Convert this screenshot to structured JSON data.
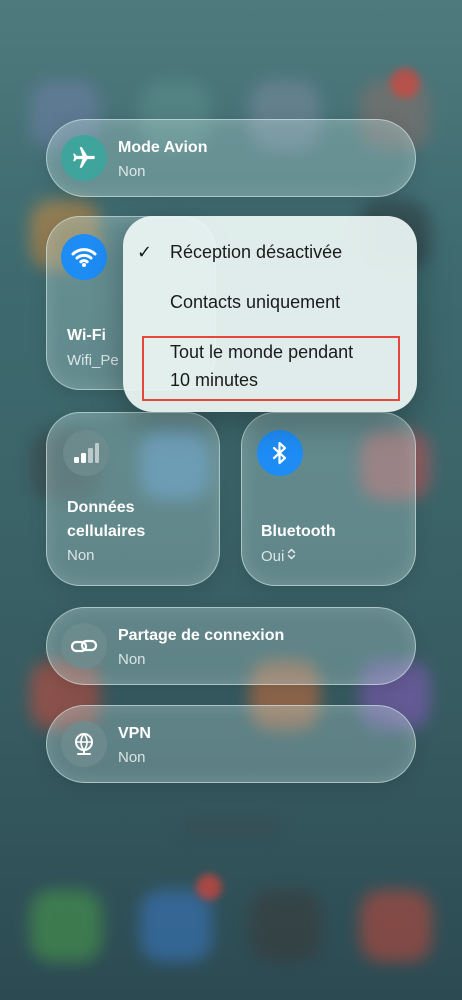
{
  "airplane": {
    "title": "Mode Avion",
    "status": "Non"
  },
  "wifi": {
    "title": "Wi-Fi",
    "network": "Wifi_Pe"
  },
  "cellular": {
    "title_line1": "Données",
    "title_line2": "cellulaires",
    "status": "Non"
  },
  "bluetooth": {
    "title": "Bluetooth",
    "status": "Oui",
    "chevron": "⌃⌄"
  },
  "hotspot": {
    "title": "Partage de connexion",
    "status": "Non"
  },
  "vpn": {
    "title": "VPN",
    "status": "Non"
  },
  "airdrop_menu": {
    "check": "✓",
    "items": [
      {
        "label": "Réception désactivée"
      },
      {
        "label": "Contacts uniquement"
      },
      {
        "label_line1": "Tout le monde pendant",
        "label_line2": "10 minutes"
      }
    ]
  },
  "colors": {
    "accent_blue": "#1e8cf5",
    "accent_teal": "#3fa49b",
    "highlight_red": "#e8463a"
  },
  "icons": [
    "airplane-icon",
    "wifi-icon",
    "cellular-bars-icon",
    "bluetooth-icon",
    "link-icon",
    "globe-vpn-icon",
    "checkmark-icon"
  ]
}
